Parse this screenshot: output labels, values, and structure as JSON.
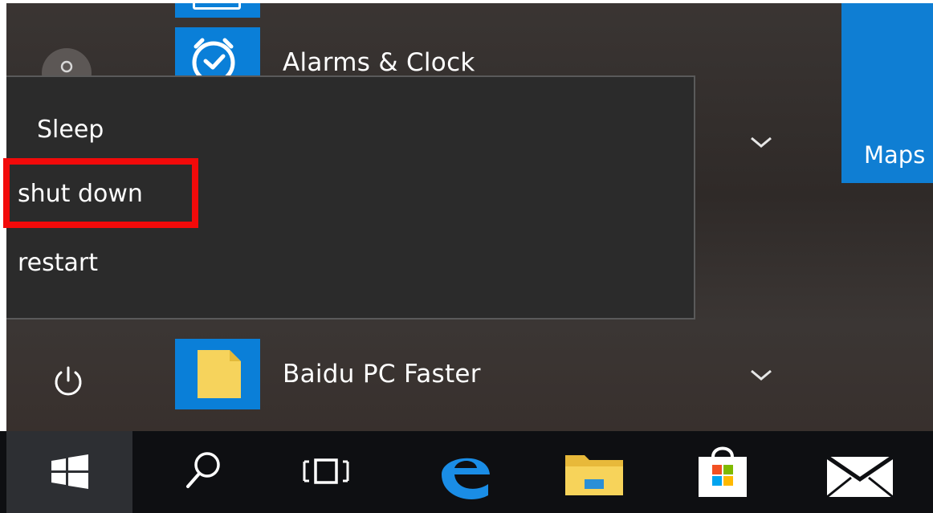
{
  "apps": {
    "alarms_label": "Alarms & Clock",
    "baidu_label": "Baidu PC Faster"
  },
  "tiles": {
    "maps_label": "Maps"
  },
  "power_menu": {
    "sleep": "Sleep",
    "shut_down": "shut down",
    "restart": "restart"
  },
  "icons": {
    "user": "user-avatar-icon",
    "alarms": "alarm-clock-icon",
    "baidu": "folder-document-icon",
    "power": "power-icon",
    "start": "windows-logo-icon",
    "search": "search-icon",
    "task_view": "task-view-icon",
    "edge": "edge-browser-icon",
    "explorer": "file-explorer-icon",
    "store": "store-icon",
    "mail": "mail-icon"
  },
  "colors": {
    "accent": "#0a7fd8",
    "highlight": "#f20a0a",
    "taskbar": "#0e0f12",
    "flyout": "#2b2b2b"
  }
}
